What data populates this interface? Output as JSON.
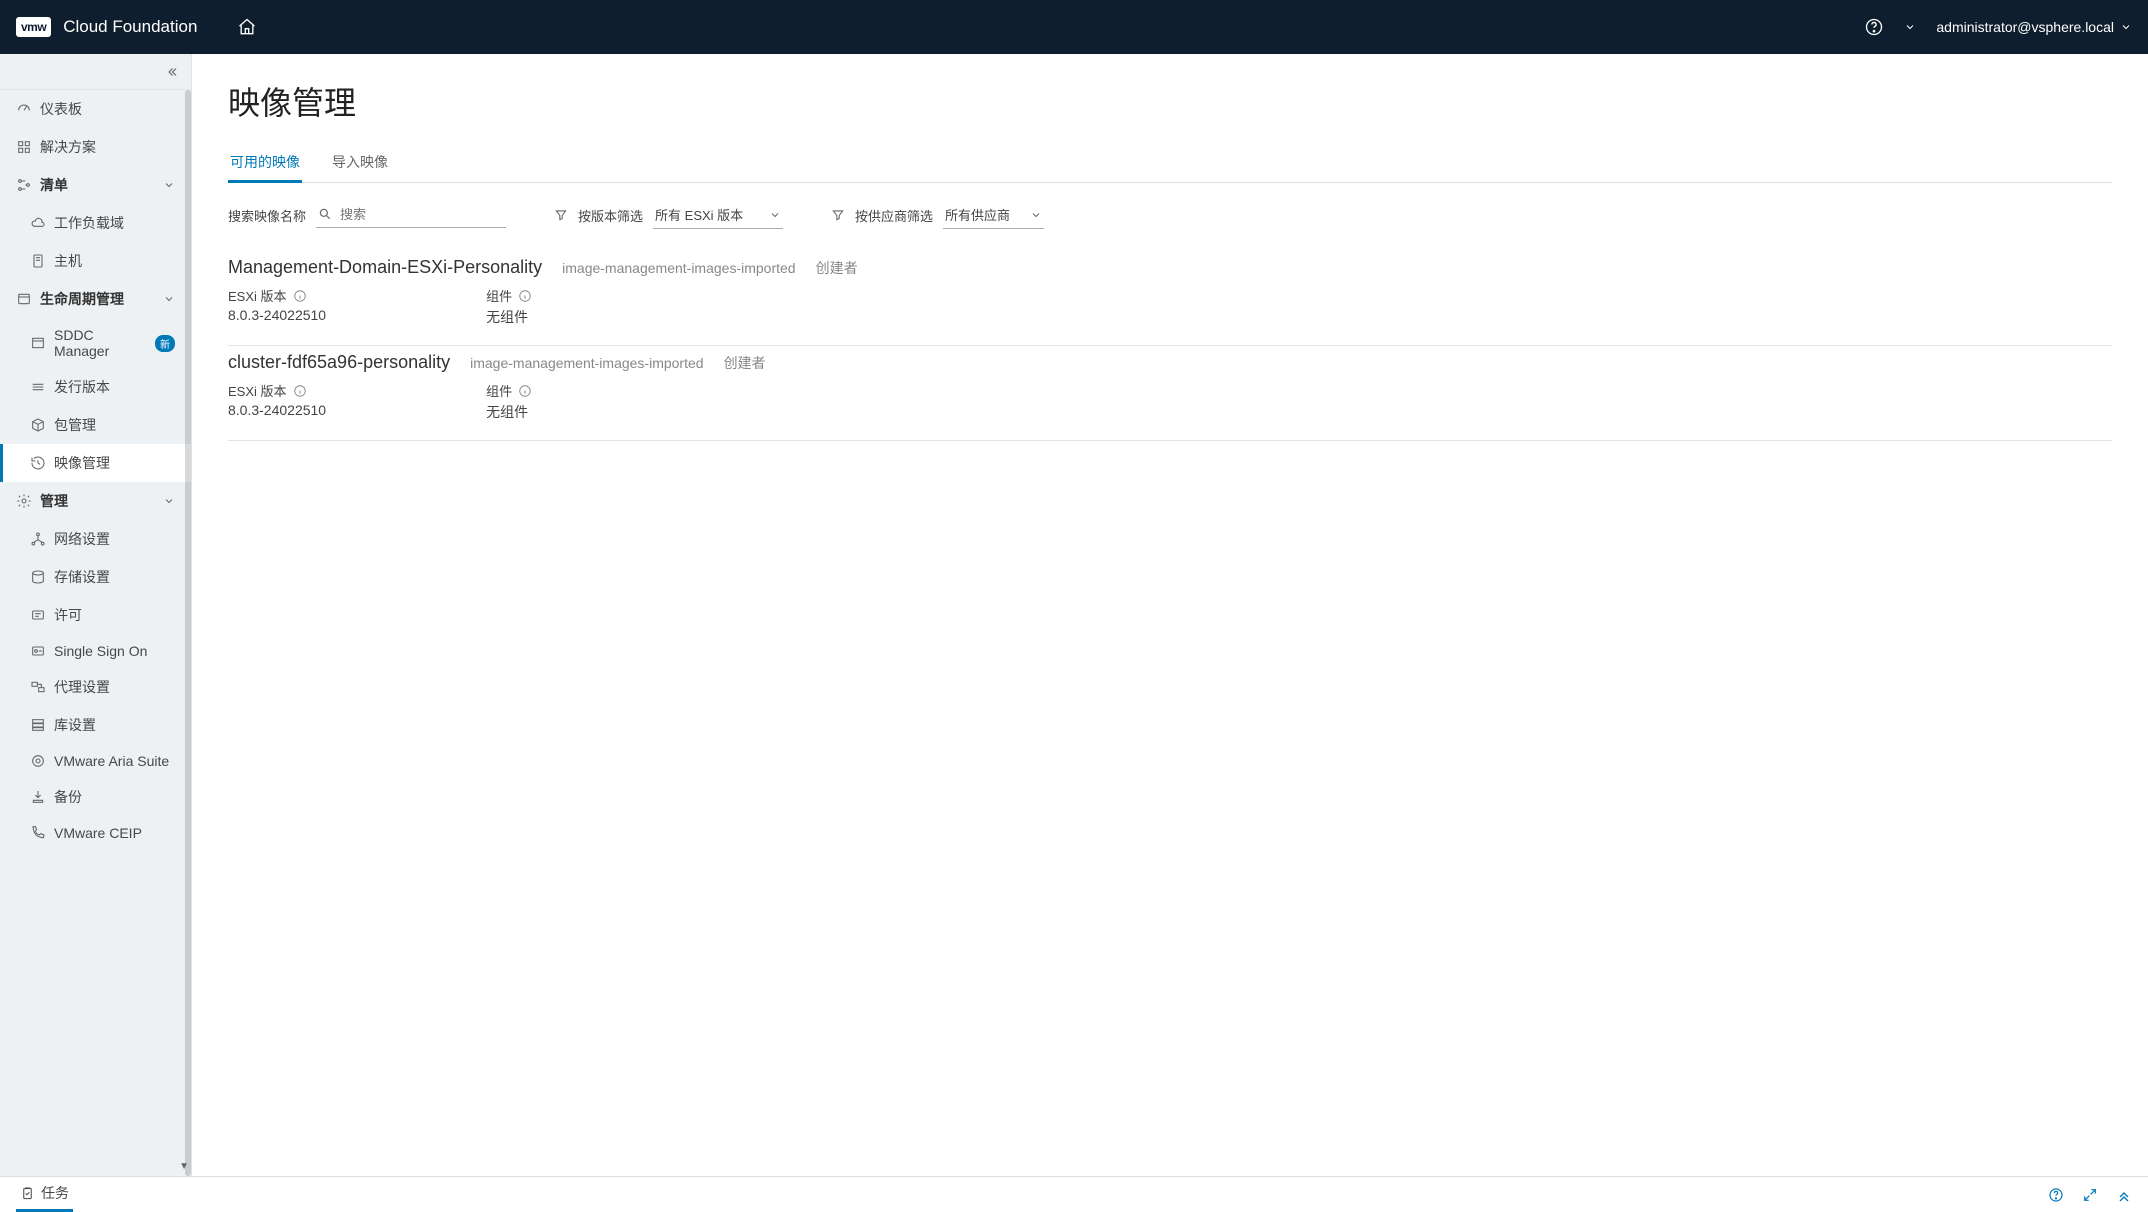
{
  "header": {
    "logo": "vmw",
    "brand": "Cloud Foundation",
    "user": "administrator@vsphere.local"
  },
  "sidebar": {
    "dashboard": "仪表板",
    "solutions": "解决方案",
    "inventory": {
      "label": "清单",
      "workload": "工作负载域",
      "hosts": "主机"
    },
    "lifecycle": {
      "label": "生命周期管理",
      "sddc": "SDDC Manager",
      "new_badge": "新",
      "release": "发行版本",
      "package": "包管理",
      "image": "映像管理"
    },
    "admin": {
      "label": "管理",
      "network": "网络设置",
      "storage": "存储设置",
      "license": "许可",
      "sso": "Single Sign On",
      "proxy": "代理设置",
      "depot": "库设置",
      "aria": "VMware Aria Suite",
      "backup": "备份",
      "ceip": "VMware CEIP"
    }
  },
  "page": {
    "title": "映像管理",
    "tabs": {
      "available": "可用的映像",
      "import": "导入映像"
    },
    "search": {
      "label": "搜索映像名称",
      "placeholder": "搜索"
    },
    "filter_version": {
      "label": "按版本筛选",
      "value": "所有 ESXi 版本"
    },
    "filter_vendor": {
      "label": "按供应商筛选",
      "value": "所有供应商"
    },
    "field_esxi": "ESXi 版本",
    "field_components": "组件",
    "creator_label": "创建者",
    "images": [
      {
        "name": "Management-Domain-ESXi-Personality",
        "status": "image-management-images-imported",
        "esxi": "8.0.3-24022510",
        "components": "无组件"
      },
      {
        "name": "cluster-fdf65a96-personality",
        "status": "image-management-images-imported",
        "esxi": "8.0.3-24022510",
        "components": "无组件"
      }
    ]
  },
  "footer": {
    "tasks": "任务"
  }
}
